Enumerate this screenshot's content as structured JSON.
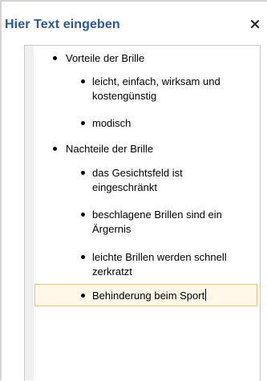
{
  "panel": {
    "title": "Hier Text eingeben",
    "close_icon": "close-icon"
  },
  "outline": [
    {
      "level": 1,
      "text": "Vorteile der Brille"
    },
    {
      "level": 2,
      "text": "leicht, einfach, wirksam und kostengünstig"
    },
    {
      "level": 2,
      "text": "modisch"
    },
    {
      "level": 1,
      "text": "Nachteile der Brille"
    },
    {
      "level": 2,
      "text": "das Gesichtsfeld ist eingeschränkt"
    },
    {
      "level": 2,
      "text": "beschlagene Brillen sind ein Ärgernis"
    },
    {
      "level": 2,
      "text": "leichte Brillen werden schnell zerkratzt"
    },
    {
      "level": 2,
      "text": "Behinderung beim Sport",
      "active": true
    }
  ],
  "colors": {
    "title": "#2b579a",
    "active_border": "#f2c16f",
    "active_bg": "#fff8e8"
  }
}
